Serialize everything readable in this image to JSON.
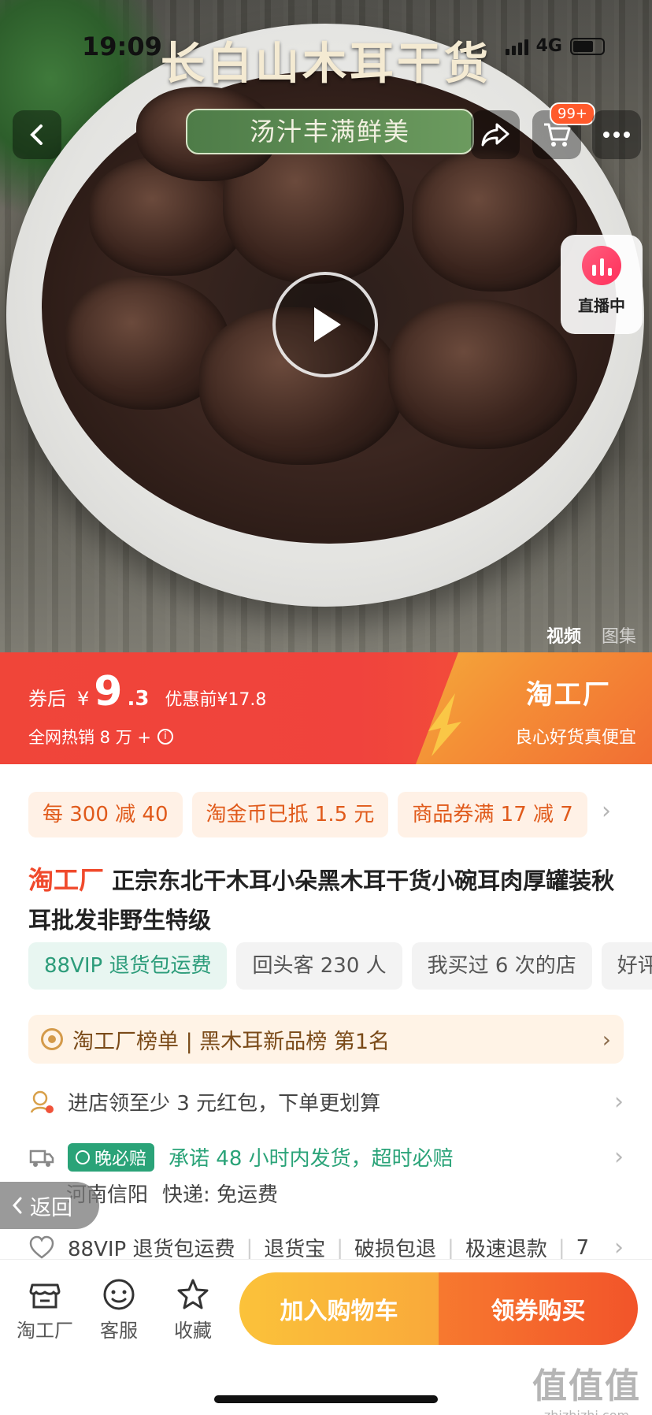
{
  "status_bar": {
    "time": "19:09",
    "network": "4G"
  },
  "hero": {
    "title": "长白山木耳干货",
    "subtitle": "汤汁丰满鲜美",
    "cart_badge": "99+",
    "live_label": "直播中",
    "media_tabs": {
      "video": "视频",
      "gallery": "图集"
    }
  },
  "price_banner": {
    "after_coupon_label": "券后",
    "currency": "¥",
    "price_int": "9",
    "price_dec": ".3",
    "original_price": "优惠前¥17.8",
    "sales": "全网热销 8 万 +",
    "brand": "淘工厂",
    "slogan": "良心好货真便宜"
  },
  "coupons": [
    "每 300 减 40",
    "淘金币已抵 1.5 元",
    "商品券满 17 减 7"
  ],
  "product": {
    "brand": "淘工厂",
    "title": " 正宗东北干木耳小朵黑木耳干货小碗耳肉厚罐装秋耳批发非野生特级"
  },
  "tags": [
    "88VIP 退货包运费",
    "回头客 230 人",
    "我买过 6 次的店",
    "好评"
  ],
  "rank": {
    "text": "淘工厂榜单 | 黑木耳新品榜  第1名"
  },
  "store_coupon": {
    "text": "进店领至少 3 元红包，下单更划算"
  },
  "shipping": {
    "badge": "晚必赔",
    "promise": "承诺 48 小时内发货，超时必赔",
    "origin": "河南信阳",
    "express": "快递: 免运费"
  },
  "services": [
    "88VIP 退货包运费",
    "退货宝",
    "破损包退",
    "极速退款",
    "7"
  ],
  "back_pill": "返回",
  "bottom_nav": [
    {
      "label": "淘工厂",
      "icon": "store-icon"
    },
    {
      "label": "客服",
      "icon": "chat-icon"
    },
    {
      "label": "收藏",
      "icon": "star-icon"
    }
  ],
  "buttons": {
    "add_to_cart": "加入购物车",
    "buy_with_coupon": "领券购买"
  },
  "watermark": {
    "big": "值值值",
    "small": "zhizhizhi.com"
  },
  "colors": {
    "accent_red": "#f04539",
    "accent_orange": "#f2542a",
    "cart_yellow": "#fbc23a",
    "green": "#2aa378"
  }
}
